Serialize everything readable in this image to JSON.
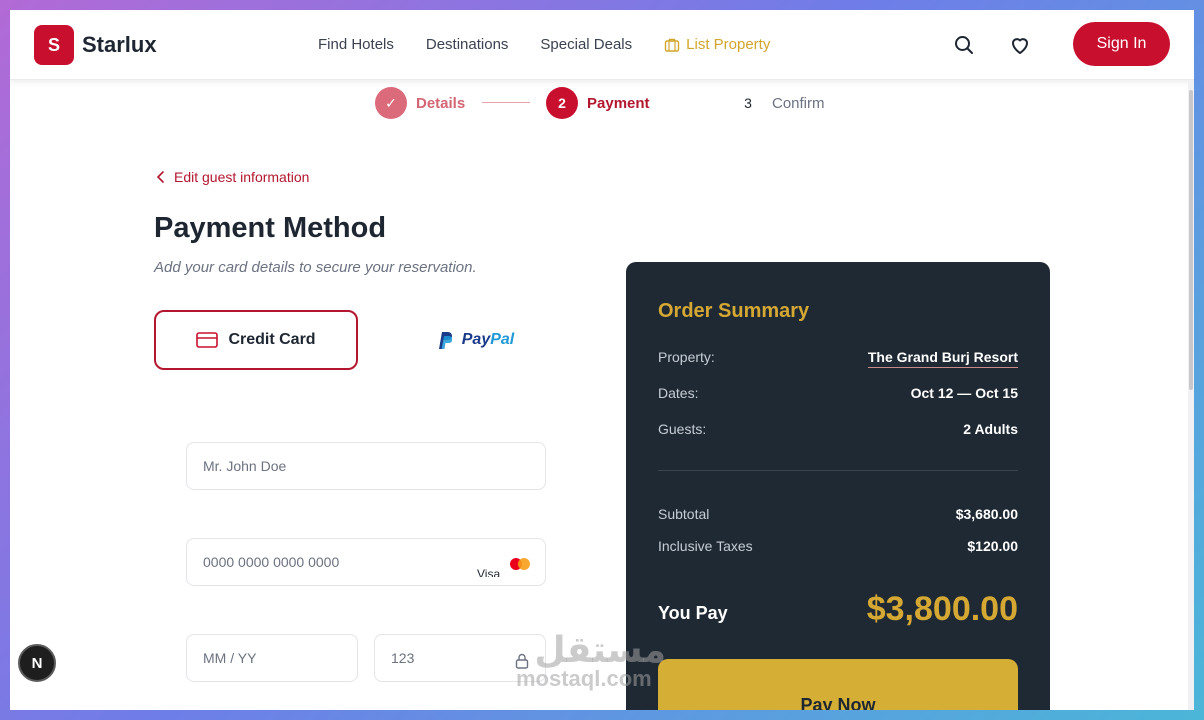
{
  "brand": {
    "logo_letter": "S",
    "name": "Starlux",
    "accent": "#c8102e",
    "gold": "#d4a832"
  },
  "nav": {
    "items": [
      "Find Hotels",
      "Destinations",
      "Special Deals"
    ],
    "list_property": "List Property",
    "sign_in": "Sign In"
  },
  "stepper": {
    "steps": [
      {
        "marker": "✓",
        "label": "Details",
        "state": "done"
      },
      {
        "marker": "2",
        "label": "Payment",
        "state": "active"
      },
      {
        "marker": "3",
        "label": "Confirm",
        "state": "pending"
      }
    ]
  },
  "form": {
    "back_link": "Edit guest information",
    "title": "Payment Method",
    "subtitle": "Add your card details to secure your reservation.",
    "methods": {
      "credit": "Credit Card",
      "paypal_pay": "Pay",
      "paypal_pal": "Pal"
    },
    "name_placeholder": "Mr. John Doe",
    "card_placeholder": "0000 0000 0000 0000",
    "card_brand_text": "Visa",
    "expiry_placeholder": "MM / YY",
    "cvc_placeholder": "123"
  },
  "summary": {
    "title": "Order Summary",
    "property_label": "Property:",
    "property_value": "The Grand Burj Resort",
    "dates_label": "Dates:",
    "dates_value": "Oct 12 — Oct 15",
    "guests_label": "Guests:",
    "guests_value": "2 Adults",
    "subtotal_label": "Subtotal",
    "subtotal_value": "$3,680.00",
    "taxes_label": "Inclusive Taxes",
    "taxes_value": "$120.00",
    "you_pay_label": "You Pay",
    "you_pay_value": "$3,800.00",
    "pay_now": "Pay Now"
  },
  "overlay": {
    "next_badge": "N",
    "watermark_ar": "مستقل",
    "watermark_en": "mostaql.com"
  }
}
